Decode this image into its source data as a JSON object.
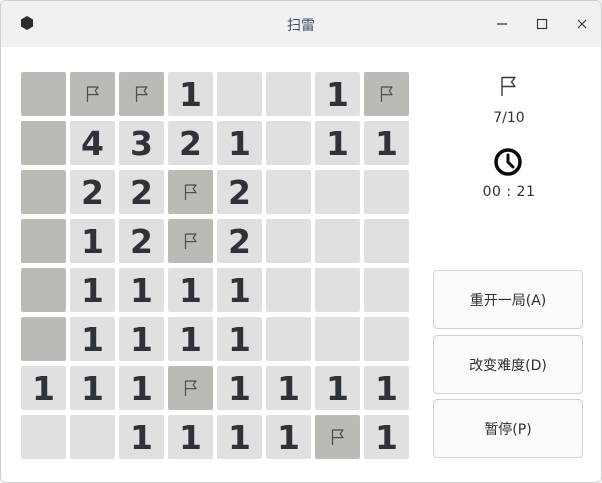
{
  "window": {
    "title": "扫雷",
    "icon": "mine-app-icon",
    "controls": [
      "minimize-icon",
      "maximize-icon",
      "close-icon"
    ]
  },
  "board": {
    "rows": 8,
    "cols": 8,
    "legend": {
      "#": "covered",
      "F": "flag",
      "1-8": "adjacent mine count",
      ".": "revealed empty"
    },
    "cells": [
      [
        "#",
        "F",
        "F",
        "1",
        ".",
        ".",
        "1",
        "F"
      ],
      [
        "#",
        "4",
        "3",
        "2",
        "1",
        ".",
        "1",
        "1"
      ],
      [
        "#",
        "2",
        "2",
        "F",
        "2",
        ".",
        ".",
        "."
      ],
      [
        "#",
        "1",
        "2",
        "F",
        "2",
        ".",
        ".",
        "."
      ],
      [
        "#",
        "1",
        "1",
        "1",
        "1",
        ".",
        ".",
        "."
      ],
      [
        "#",
        "1",
        "1",
        "1",
        "1",
        ".",
        ".",
        "."
      ],
      [
        "1",
        "1",
        "1",
        "F",
        "1",
        "1",
        "1",
        "1"
      ],
      [
        ".",
        ".",
        "1",
        "1",
        "1",
        "1",
        "F",
        "1"
      ]
    ]
  },
  "status": {
    "flag_icon": "flag-icon",
    "mine_count": "7/10",
    "clock_icon": "clock-icon",
    "timer": "00 : 21"
  },
  "actions": {
    "restart_label": "重开一局(A)",
    "difficulty_label": "改变难度(D)",
    "pause_label": "暂停(P)"
  },
  "colors": {
    "covered_cell": "#b9bcb5",
    "revealed_cell": "#e0e0e0",
    "number_text": "#2f3238",
    "title_text": "#414d68"
  }
}
